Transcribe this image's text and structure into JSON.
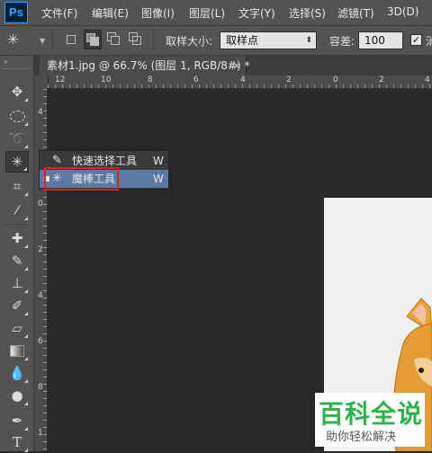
{
  "app": {
    "logo": "Ps"
  },
  "menu": [
    "文件(F)",
    "编辑(E)",
    "图像(I)",
    "图层(L)",
    "文字(Y)",
    "选择(S)",
    "滤镜(T)",
    "3D(D)"
  ],
  "options": {
    "sample_size_label": "取样大小:",
    "sample_size_value": "取样点",
    "tolerance_label": "容差:",
    "tolerance_value": "100",
    "checkbox_label": "消"
  },
  "document": {
    "tab_title": "素材1.jpg @ 66.7% (图层 1, RGB/8#) *",
    "close": "×"
  },
  "ruler_top": [
    "12",
    "10",
    "8",
    "6",
    "4",
    "2",
    "0",
    "2",
    "4"
  ],
  "ruler_left": [
    "4",
    "2",
    "0",
    "2",
    "4",
    "6",
    "8",
    "1"
  ],
  "flyout": {
    "items": [
      {
        "label": "快速选择工具",
        "shortcut": "W"
      },
      {
        "label": "魔棒工具",
        "shortcut": "W"
      }
    ]
  },
  "watermark": {
    "title": "百科全说",
    "subtitle": "助你轻松解决"
  },
  "colors": {
    "panel": "#535353",
    "workspace": "#282828",
    "highlight_red": "#e11f1f",
    "selected_item": "#5c7aa3",
    "watermark_green": "#2eb34a"
  }
}
